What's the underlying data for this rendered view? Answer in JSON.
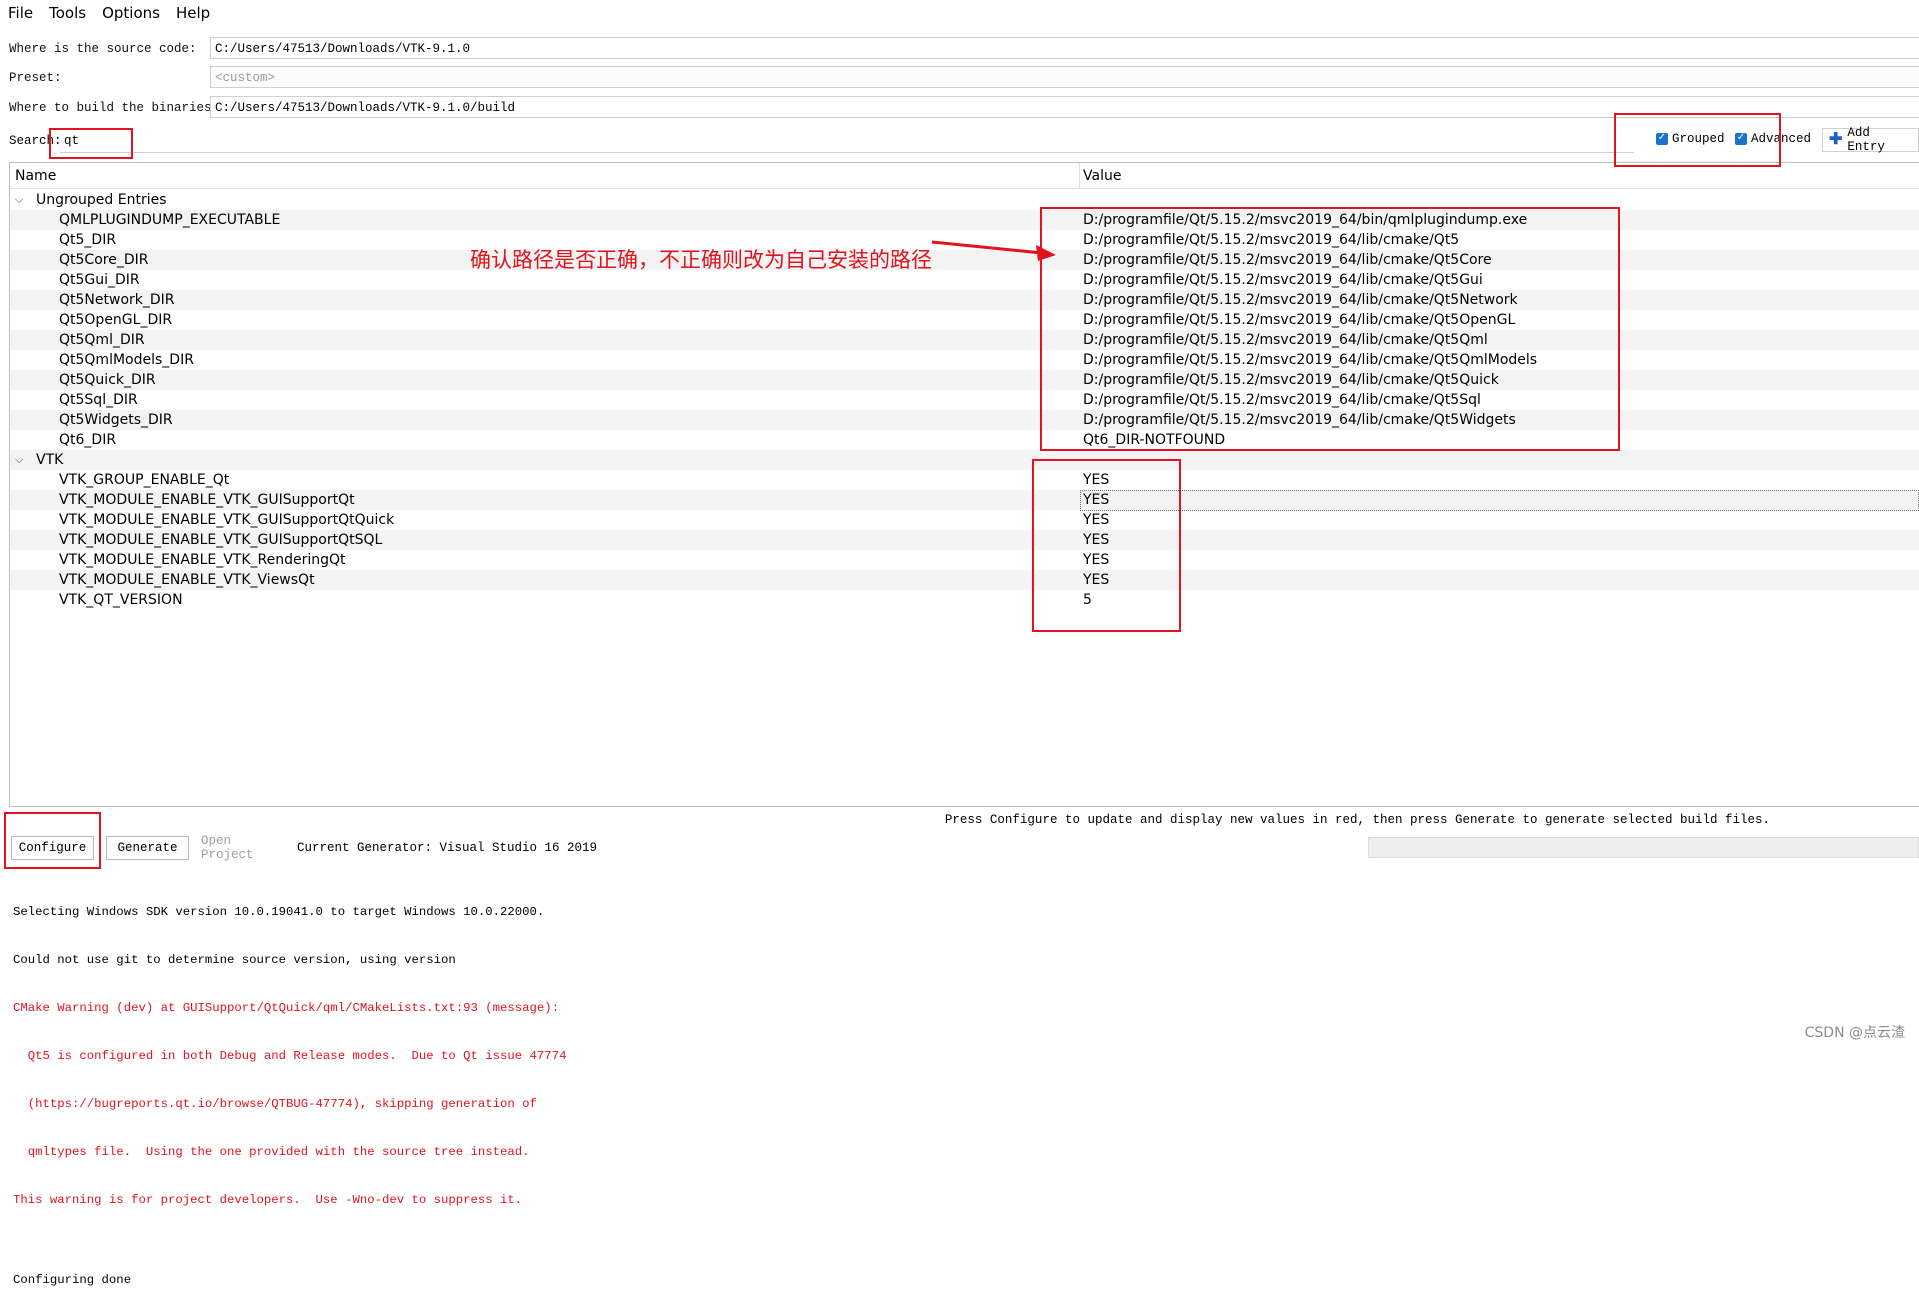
{
  "menubar": {
    "items": [
      "File",
      "Tools",
      "Options",
      "Help"
    ]
  },
  "form": {
    "source_label": "Where is the source code:",
    "source_value": "C:/Users/47513/Downloads/VTK-9.1.0",
    "preset_label": "Preset:",
    "preset_value": "<custom>",
    "build_label": "Where to build the binaries:",
    "build_value": "C:/Users/47513/Downloads/VTK-9.1.0/build"
  },
  "search": {
    "label": "Search:",
    "value": "qt"
  },
  "options": {
    "grouped_label": "Grouped",
    "grouped_checked": true,
    "advanced_label": "Advanced",
    "advanced_checked": true,
    "add_entry_label": "Add Entry"
  },
  "tree": {
    "col_name": "Name",
    "col_value": "Value",
    "groups": [
      {
        "name": "Ungrouped Entries",
        "entries": [
          {
            "name": "QMLPLUGINDUMP_EXECUTABLE",
            "value": "D:/programfile/Qt/5.15.2/msvc2019_64/bin/qmlplugindump.exe"
          },
          {
            "name": "Qt5_DIR",
            "value": "D:/programfile/Qt/5.15.2/msvc2019_64/lib/cmake/Qt5"
          },
          {
            "name": "Qt5Core_DIR",
            "value": "D:/programfile/Qt/5.15.2/msvc2019_64/lib/cmake/Qt5Core"
          },
          {
            "name": "Qt5Gui_DIR",
            "value": "D:/programfile/Qt/5.15.2/msvc2019_64/lib/cmake/Qt5Gui"
          },
          {
            "name": "Qt5Network_DIR",
            "value": "D:/programfile/Qt/5.15.2/msvc2019_64/lib/cmake/Qt5Network"
          },
          {
            "name": "Qt5OpenGL_DIR",
            "value": "D:/programfile/Qt/5.15.2/msvc2019_64/lib/cmake/Qt5OpenGL"
          },
          {
            "name": "Qt5Qml_DIR",
            "value": "D:/programfile/Qt/5.15.2/msvc2019_64/lib/cmake/Qt5Qml"
          },
          {
            "name": "Qt5QmlModels_DIR",
            "value": "D:/programfile/Qt/5.15.2/msvc2019_64/lib/cmake/Qt5QmlModels"
          },
          {
            "name": "Qt5Quick_DIR",
            "value": "D:/programfile/Qt/5.15.2/msvc2019_64/lib/cmake/Qt5Quick"
          },
          {
            "name": "Qt5Sql_DIR",
            "value": "D:/programfile/Qt/5.15.2/msvc2019_64/lib/cmake/Qt5Sql"
          },
          {
            "name": "Qt5Widgets_DIR",
            "value": "D:/programfile/Qt/5.15.2/msvc2019_64/lib/cmake/Qt5Widgets"
          },
          {
            "name": "Qt6_DIR",
            "value": "Qt6_DIR-NOTFOUND"
          }
        ]
      },
      {
        "name": "VTK",
        "entries": [
          {
            "name": "VTK_GROUP_ENABLE_Qt",
            "value": "YES"
          },
          {
            "name": "VTK_MODULE_ENABLE_VTK_GUISupportQt",
            "value": "YES"
          },
          {
            "name": "VTK_MODULE_ENABLE_VTK_GUISupportQtQuick",
            "value": "YES"
          },
          {
            "name": "VTK_MODULE_ENABLE_VTK_GUISupportQtSQL",
            "value": "YES"
          },
          {
            "name": "VTK_MODULE_ENABLE_VTK_RenderingQt",
            "value": "YES"
          },
          {
            "name": "VTK_MODULE_ENABLE_VTK_ViewsQt",
            "value": "YES"
          },
          {
            "name": "VTK_QT_VERSION",
            "value": "5"
          }
        ]
      }
    ]
  },
  "annotation": {
    "text": "确认路径是否正确，不正确则改为自己安装的路径",
    "color": "#e0141e"
  },
  "status_message": "Press Configure to update and display new values in red, then press Generate to generate selected build files.",
  "buttons": {
    "configure": "Configure",
    "generate": "Generate",
    "open_project": "Open Project"
  },
  "generator": "Current Generator: Visual Studio 16 2019",
  "log": [
    {
      "text": "Selecting Windows SDK version 10.0.19041.0 to target Windows 10.0.22000.",
      "red": false
    },
    {
      "text": "Could not use git to determine source version, using version",
      "red": false
    },
    {
      "text": "CMake Warning (dev) at GUISupport/QtQuick/qml/CMakeLists.txt:93 (message):",
      "red": true
    },
    {
      "text": "  Qt5 is configured in both Debug and Release modes.  Due to Qt issue 47774",
      "red": true
    },
    {
      "text": "  (https://bugreports.qt.io/browse/QTBUG-47774), skipping generation of",
      "red": true
    },
    {
      "text": "  qmltypes file.  Using the one provided with the source tree instead.",
      "red": true
    },
    {
      "text": "This warning is for project developers.  Use -Wno-dev to suppress it.",
      "red": true
    },
    {
      "text": "",
      "red": false
    },
    {
      "text": "Configuring done",
      "red": false
    }
  ],
  "watermark": "CSDN @点云渣"
}
